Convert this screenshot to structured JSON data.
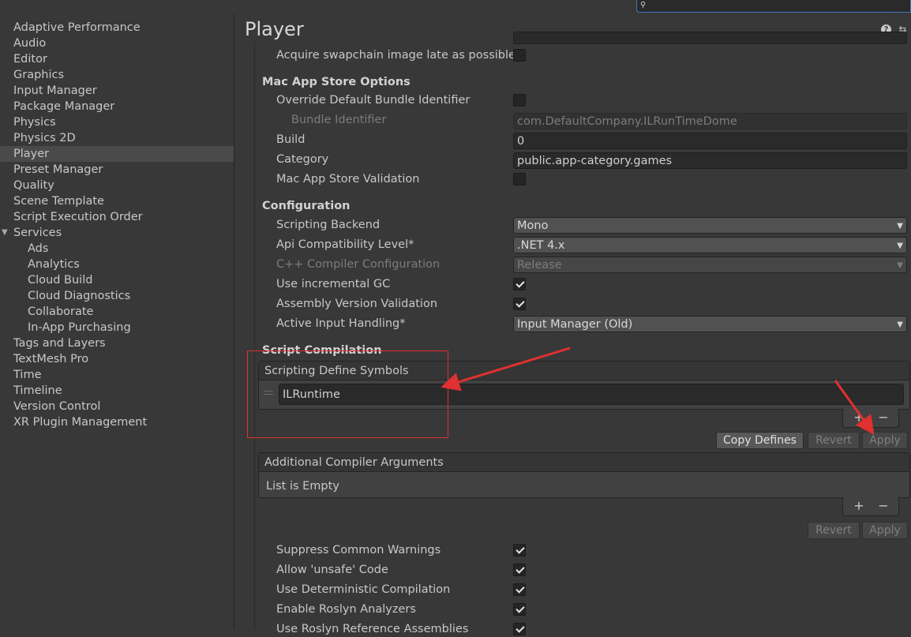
{
  "search": {
    "icon": "search-icon",
    "value": ""
  },
  "sidebar": {
    "items": [
      {
        "label": "Adaptive Performance"
      },
      {
        "label": "Audio"
      },
      {
        "label": "Editor"
      },
      {
        "label": "Graphics"
      },
      {
        "label": "Input Manager"
      },
      {
        "label": "Package Manager"
      },
      {
        "label": "Physics"
      },
      {
        "label": "Physics 2D"
      },
      {
        "label": "Player",
        "selected": true
      },
      {
        "label": "Preset Manager"
      },
      {
        "label": "Quality"
      },
      {
        "label": "Scene Template"
      },
      {
        "label": "Script Execution Order"
      },
      {
        "label": "Services",
        "expanded": true
      },
      {
        "label": "Ads",
        "child": true
      },
      {
        "label": "Analytics",
        "child": true
      },
      {
        "label": "Cloud Build",
        "child": true
      },
      {
        "label": "Cloud Diagnostics",
        "child": true
      },
      {
        "label": "Collaborate",
        "child": true
      },
      {
        "label": "In-App Purchasing",
        "child": true
      },
      {
        "label": "Tags and Layers"
      },
      {
        "label": "TextMesh Pro"
      },
      {
        "label": "Time"
      },
      {
        "label": "Timeline"
      },
      {
        "label": "Version Control"
      },
      {
        "label": "XR Plugin Management"
      }
    ]
  },
  "header": {
    "title": "Player",
    "help_icon": "help-icon",
    "presets_icon": "presets-icon",
    "help_glyph": "?",
    "presets_glyph": "⇆"
  },
  "settings": {
    "swapchain_label": "Acquire swapchain image late as possible",
    "mac_section": "Mac App Store Options",
    "override_bundle_label": "Override Default Bundle Identifier",
    "bundle_id_label": "Bundle Identifier",
    "bundle_id_value": "com.DefaultCompany.ILRunTimeDome",
    "build_label": "Build",
    "build_value": "0",
    "category_label": "Category",
    "category_value": "public.app-category.games",
    "validation_label": "Mac App Store Validation",
    "config_section": "Configuration",
    "backend_label": "Scripting Backend",
    "backend_value": "Mono",
    "api_label": "Api Compatibility Level*",
    "api_value": ".NET 4.x",
    "cpp_label": "C++ Compiler Configuration",
    "cpp_value": "Release",
    "incgc_label": "Use incremental GC",
    "incgc_checked": true,
    "asmver_label": "Assembly Version Validation",
    "asmver_checked": true,
    "input_label": "Active Input Handling*",
    "input_value": "Input Manager (Old)",
    "compilation_section": "Script Compilation",
    "define_symbols_header": "Scripting Define Symbols",
    "define_symbols": [
      "ILRuntime"
    ],
    "copy_defines": "Copy Defines",
    "revert": "Revert",
    "apply": "Apply",
    "compiler_args_header": "Additional Compiler Arguments",
    "compiler_args_empty": "List is Empty",
    "plus": "+",
    "minus": "−",
    "suppress_label": "Suppress Common Warnings",
    "unsafe_label": "Allow 'unsafe' Code",
    "deterministic_label": "Use Deterministic Compilation",
    "roslyn_label": "Enable Roslyn Analyzers",
    "roslyn_ref_label": "Use Roslyn Reference Assemblies",
    "dropdown_arrow": "▼"
  },
  "colors": {
    "annotation": "#e03030",
    "selection": "#4a4a4a",
    "search_border": "#3a79bb"
  }
}
